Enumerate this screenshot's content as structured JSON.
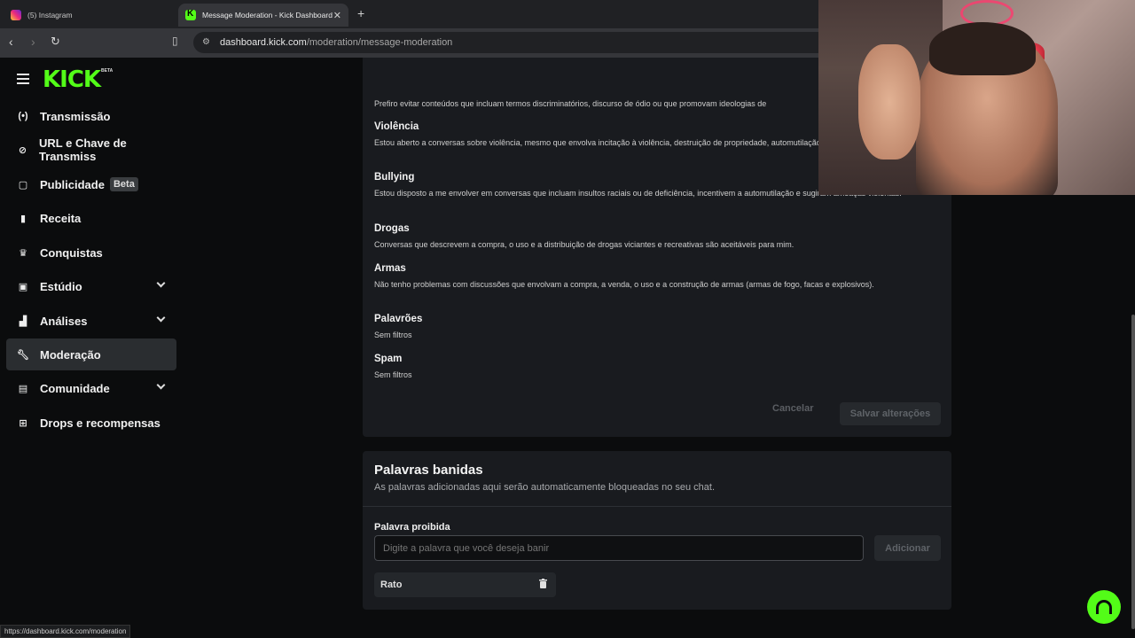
{
  "browser": {
    "tabs": [
      {
        "title": "(5) Instagram",
        "active": false
      },
      {
        "title": "Message Moderation - Kick Dashboard",
        "active": true
      }
    ],
    "url_domain": "dashboard.kick.com",
    "url_path": "/moderation/message-moderation",
    "status_url": "https://dashboard.kick.com/moderation"
  },
  "sidebar": {
    "logo": "KICK",
    "logo_badge": "BETA",
    "items": [
      {
        "label": "Transmissão",
        "icon": "broadcast-icon"
      },
      {
        "label": "URL e Chave de Transmiss",
        "icon": "link-icon"
      },
      {
        "label": "Publicidade",
        "icon": "ad-icon",
        "badge": "Beta"
      },
      {
        "label": "Receita",
        "icon": "revenue-icon"
      },
      {
        "label": "Conquistas",
        "icon": "trophy-icon"
      },
      {
        "label": "Estúdio",
        "icon": "studio-icon",
        "expandable": true
      },
      {
        "label": "Análises",
        "icon": "chart-icon",
        "expandable": true
      },
      {
        "label": "Moderação",
        "icon": "wrench-icon",
        "active": true
      },
      {
        "label": "Comunidade",
        "icon": "community-icon",
        "expandable": true
      },
      {
        "label": "Drops e recompensas",
        "icon": "gift-icon"
      }
    ]
  },
  "moderation": {
    "intro_text": "Prefiro evitar conteúdos que incluam termos discriminatórios, discurso de ódio ou que promovam ideologias de",
    "sections": [
      {
        "title": "Violência",
        "desc": "Estou aberto a conversas sobre violência, mesmo que envolva incitação à violência, destruição de propriedade, automutilação."
      },
      {
        "title": "Bullying",
        "desc": "Estou disposto a me envolver em conversas que incluam insultos raciais ou de deficiência, incentivem a automutilação e sugiram ameaças violentas."
      },
      {
        "title": "Drogas",
        "desc": "Conversas que descrevem a compra, o uso e a distribuição de drogas viciantes e recreativas são aceitáveis para mim."
      },
      {
        "title": "Armas",
        "desc": "Não tenho problemas com discussões que envolvam a compra, a venda, o uso e a construção de armas (armas de fogo, facas e explosivos)."
      },
      {
        "title": "Palavrões",
        "desc": "Sem filtros"
      },
      {
        "title": "Spam",
        "desc": "Sem filtros"
      }
    ],
    "cancel_label": "Cancelar",
    "save_label": "Salvar alterações"
  },
  "banned_words": {
    "title": "Palavras banidas",
    "subtitle": "As palavras adicionadas aqui serão automaticamente bloqueadas no seu chat.",
    "field_label": "Palavra proibida",
    "placeholder": "Digite a palavra que você deseja banir",
    "add_label": "Adicionar",
    "words": [
      "Rato"
    ]
  },
  "colors": {
    "brand": "#53fc18",
    "card_bg": "#191b1f",
    "page_bg": "#0b0c0d"
  }
}
